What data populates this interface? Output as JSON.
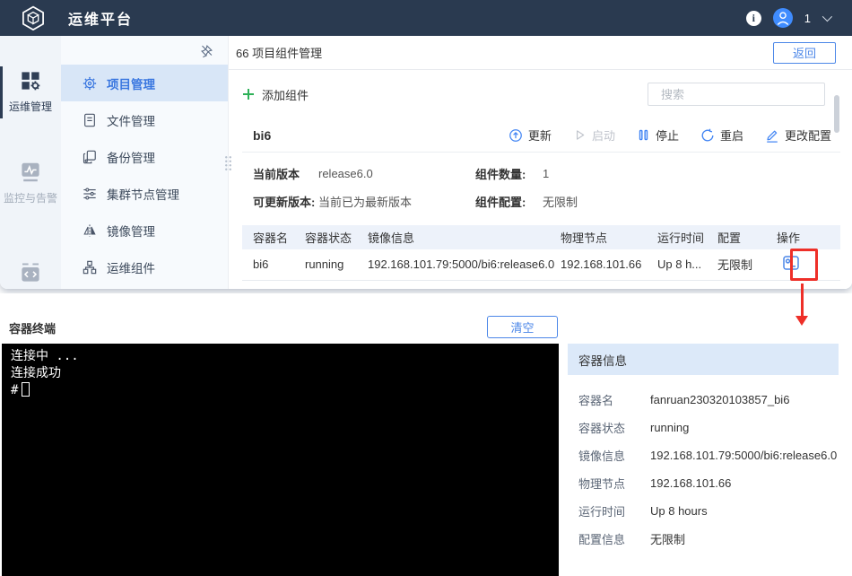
{
  "header": {
    "title": "运维平台",
    "user_count": "1"
  },
  "rail": {
    "items": [
      {
        "label": "运维管理",
        "icon": "ops-grid-gear-icon",
        "active": true
      },
      {
        "label": "监控与告警",
        "icon": "monitor-chart-icon",
        "active": false
      },
      {
        "label": "",
        "icon": "code-icon",
        "active": false
      }
    ]
  },
  "sidebar": {
    "pin_icon": "pin-off-icon",
    "items": [
      {
        "label": "项目管理",
        "icon": "gear-icon",
        "active": true
      },
      {
        "label": "文件管理",
        "icon": "file-icon",
        "active": false
      },
      {
        "label": "备份管理",
        "icon": "backup-copy-icon",
        "active": false
      },
      {
        "label": "集群节点管理",
        "icon": "cluster-sliders-icon",
        "active": false
      },
      {
        "label": "镜像管理",
        "icon": "mirror-icon",
        "active": false
      },
      {
        "label": "运维组件",
        "icon": "components-icon",
        "active": false
      }
    ]
  },
  "breadcrumb": {
    "title": "66 项目组件管理",
    "back_label": "返回"
  },
  "toolbar": {
    "add_label": "添加组件",
    "add_icon": "plus-icon",
    "search_placeholder": "搜索",
    "search_icon": "search-icon"
  },
  "component": {
    "name": "bi6",
    "actions": [
      {
        "label": "更新",
        "icon": "update-icon",
        "disabled": false
      },
      {
        "label": "启动",
        "icon": "play-icon",
        "disabled": true
      },
      {
        "label": "停止",
        "icon": "pause-icon",
        "disabled": false
      },
      {
        "label": "重启",
        "icon": "restart-icon",
        "disabled": false
      },
      {
        "label": "更改配置",
        "icon": "edit-icon",
        "disabled": false
      }
    ],
    "info_rows": [
      {
        "label": "当前版本",
        "value": "release6.0"
      },
      {
        "label": "组件数量:",
        "value": "1"
      },
      {
        "label": "可更新版本:",
        "value": "当前已为最新版本"
      },
      {
        "label": "组件配置:",
        "value": "无限制"
      }
    ],
    "table": {
      "headers": [
        "容器名",
        "容器状态",
        "镜像信息",
        "物理节点",
        "运行时间",
        "配置",
        "操作"
      ],
      "row": {
        "name": "bi6",
        "status": "running",
        "image": "192.168.101.79:5000/bi6:release6.0",
        "node": "192.168.101.66",
        "uptime": "Up 8 h...",
        "config": "无限制",
        "op_icon": "terminal-icon"
      }
    }
  },
  "terminal": {
    "title": "容器终端",
    "clear_label": "清空",
    "lines": [
      "连接中 ...",
      "连接成功"
    ],
    "prompt": "#"
  },
  "container_info": {
    "title": "容器信息",
    "fields": [
      {
        "label": "容器名",
        "value": "fanruan230320103857_bi6"
      },
      {
        "label": "容器状态",
        "value": "running"
      },
      {
        "label": "镜像信息",
        "value": "192.168.101.79:5000/bi6:release6.0"
      },
      {
        "label": "物理节点",
        "value": "192.168.101.66"
      },
      {
        "label": "运行时间",
        "value": "Up 8 hours"
      },
      {
        "label": "配置信息",
        "value": "无限制"
      }
    ]
  },
  "colors": {
    "header_navy": "#2a3a50",
    "accent_blue": "#4c87e8",
    "running_green": "#2db55d",
    "annotation_red": "#ee2f28",
    "selected_menu_bg": "#d8e6f7",
    "table_header_bg": "#edf2fa"
  }
}
